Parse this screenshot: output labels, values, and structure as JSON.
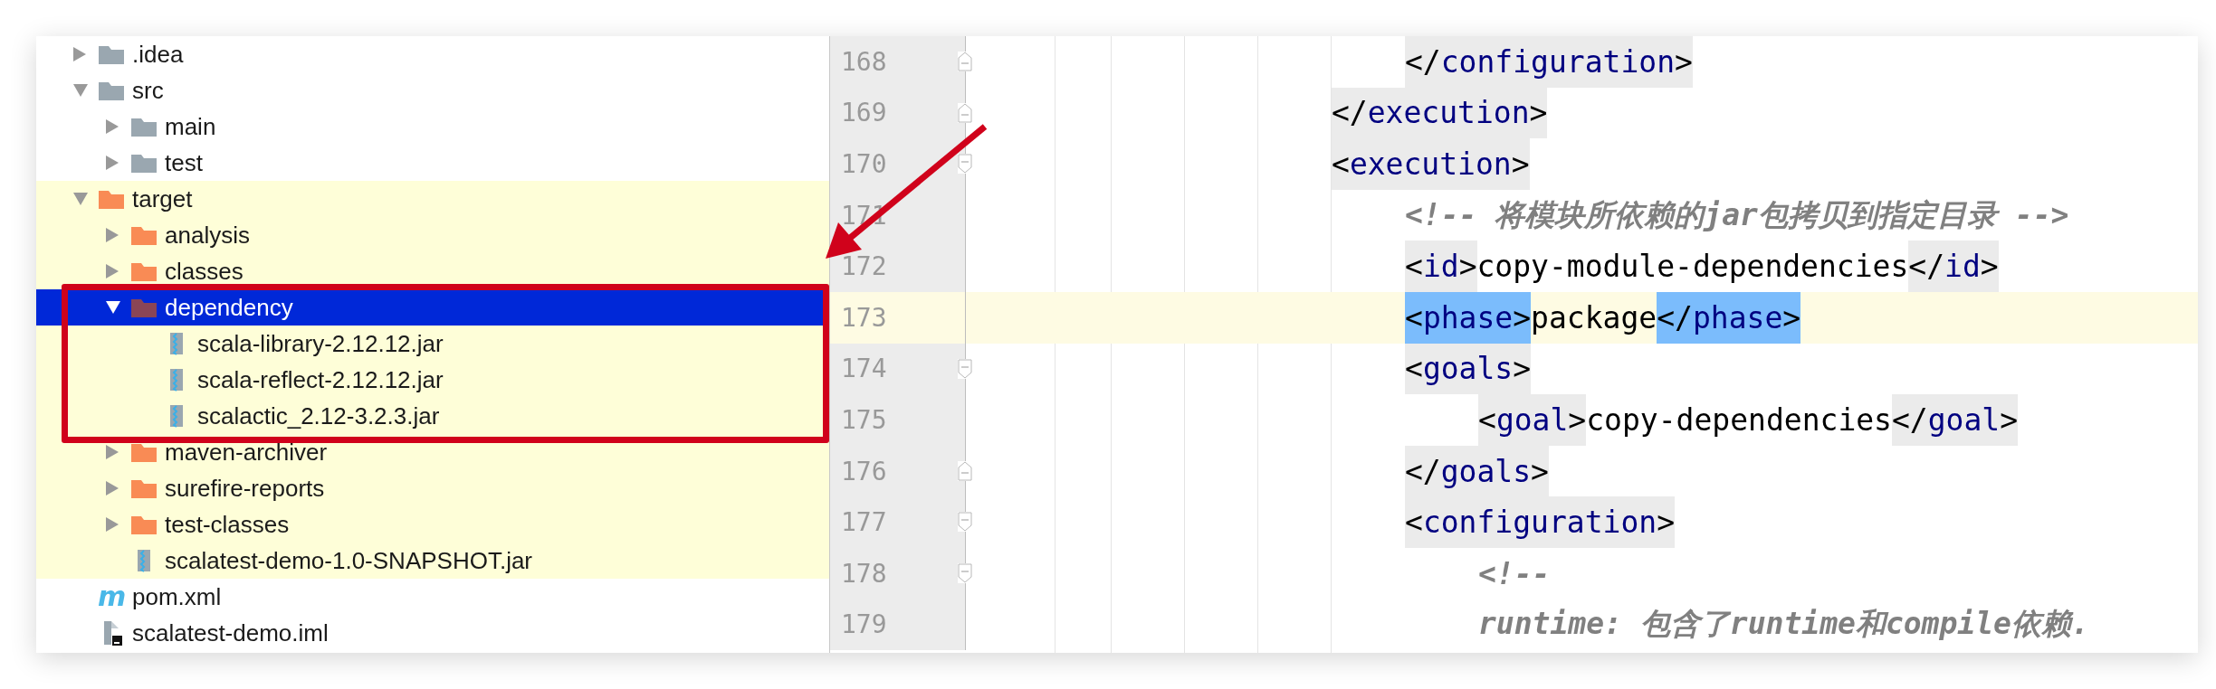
{
  "project_tree": [
    {
      "label": ".idea",
      "kind": "folder",
      "expanded": false,
      "selected": false,
      "excluded": false
    },
    {
      "label": "src",
      "kind": "folder",
      "expanded": true,
      "selected": false,
      "excluded": false,
      "children": [
        {
          "label": "main",
          "kind": "folder",
          "expanded": false,
          "selected": false,
          "excluded": false
        },
        {
          "label": "test",
          "kind": "folder",
          "expanded": false,
          "selected": false,
          "excluded": false
        }
      ]
    },
    {
      "label": "target",
      "kind": "folder",
      "expanded": true,
      "selected": false,
      "excluded": true,
      "children": [
        {
          "label": "analysis",
          "kind": "folder",
          "expanded": false,
          "selected": false,
          "excluded": true
        },
        {
          "label": "classes",
          "kind": "folder",
          "expanded": false,
          "selected": false,
          "excluded": true
        },
        {
          "label": "dependency",
          "kind": "folder",
          "expanded": true,
          "selected": true,
          "excluded": true,
          "children": [
            {
              "label": "scala-library-2.12.12.jar",
              "kind": "jar",
              "selected": false,
              "excluded": true
            },
            {
              "label": "scala-reflect-2.12.12.jar",
              "kind": "jar",
              "selected": false,
              "excluded": true
            },
            {
              "label": "scalactic_2.12-3.2.3.jar",
              "kind": "jar",
              "selected": false,
              "excluded": true
            }
          ]
        },
        {
          "label": "maven-archiver",
          "kind": "folder",
          "expanded": false,
          "selected": false,
          "excluded": true
        },
        {
          "label": "surefire-reports",
          "kind": "folder",
          "expanded": false,
          "selected": false,
          "excluded": true
        },
        {
          "label": "test-classes",
          "kind": "folder",
          "expanded": false,
          "selected": false,
          "excluded": true
        },
        {
          "label": "scalatest-demo-1.0-SNAPSHOT.jar",
          "kind": "jar",
          "selected": false,
          "excluded": true
        }
      ]
    },
    {
      "label": "pom.xml",
      "kind": "maven",
      "badge": "m",
      "selected": false,
      "excluded": false
    },
    {
      "label": "scalatest-demo.iml",
      "kind": "module",
      "selected": false,
      "excluded": false
    }
  ],
  "editor": {
    "lines": [
      {
        "children": [
          {
            "number": "168",
            "fold_start": false,
            "fold_end": true,
            "current": false,
            "tokens": [
              {
                "kind": "tag",
                "parts": [
                  "</",
                  "configuration",
                  ">"
                ],
                "matched": false
              }
            ]
          }
        ]
      },
      {
        "number": "169",
        "fold_start": false,
        "fold_end": true,
        "current": false,
        "tokens": [
          {
            "kind": "tag",
            "parts": [
              "</",
              "execution",
              ">"
            ],
            "matched": false
          }
        ]
      },
      {
        "number": "170",
        "fold_start": true,
        "fold_end": false,
        "current": false,
        "tokens": [
          {
            "kind": "tag",
            "parts": [
              "<",
              "execution",
              ">"
            ],
            "matched": false
          }
        ],
        "children": [
          {
            "number": "171",
            "fold_start": false,
            "fold_end": false,
            "current": false,
            "tokens": [
              {
                "kind": "comment",
                "text": "<!-- 将模块所依赖的jar包拷贝到指定目录 -->"
              }
            ]
          },
          {
            "number": "172",
            "fold_start": false,
            "fold_end": false,
            "current": false,
            "tokens": [
              {
                "kind": "tag",
                "parts": [
                  "<",
                  "id",
                  ">"
                ],
                "matched": false
              },
              {
                "kind": "text",
                "text": "copy-module-dependencies"
              },
              {
                "kind": "tag",
                "parts": [
                  "</",
                  "id",
                  ">"
                ],
                "matched": false
              }
            ]
          },
          {
            "number": "173",
            "fold_start": false,
            "fold_end": false,
            "current": true,
            "tokens": [
              {
                "kind": "tag",
                "parts": [
                  "<",
                  "phase",
                  ">"
                ],
                "matched": true
              },
              {
                "kind": "text",
                "text": "package"
              },
              {
                "kind": "tag",
                "parts": [
                  "</",
                  "phase",
                  ">"
                ],
                "matched": true
              }
            ]
          },
          {
            "number": "174",
            "fold_start": true,
            "fold_end": false,
            "current": false,
            "tokens": [
              {
                "kind": "tag",
                "parts": [
                  "<",
                  "goals",
                  ">"
                ],
                "matched": false
              }
            ],
            "children": [
              {
                "number": "175",
                "fold_start": false,
                "fold_end": false,
                "current": false,
                "tokens": [
                  {
                    "kind": "tag",
                    "parts": [
                      "<",
                      "goal",
                      ">"
                    ],
                    "matched": false
                  },
                  {
                    "kind": "text",
                    "text": "copy-dependencies"
                  },
                  {
                    "kind": "tag",
                    "parts": [
                      "</",
                      "goal",
                      ">"
                    ],
                    "matched": false
                  }
                ]
              }
            ]
          },
          {
            "number": "176",
            "fold_start": false,
            "fold_end": true,
            "current": false,
            "tokens": [
              {
                "kind": "tag",
                "parts": [
                  "</",
                  "goals",
                  ">"
                ],
                "matched": false
              }
            ]
          },
          {
            "number": "177",
            "fold_start": true,
            "fold_end": false,
            "current": false,
            "tokens": [
              {
                "kind": "tag",
                "parts": [
                  "<",
                  "configuration",
                  ">"
                ],
                "matched": false
              }
            ],
            "children": [
              {
                "number": "178",
                "fold_start": true,
                "fold_end": false,
                "current": false,
                "tokens": [
                  {
                    "kind": "comment",
                    "text": "<!--"
                  }
                ]
              },
              {
                "number": "179",
                "fold_start": false,
                "fold_end": false,
                "current": false,
                "tokens": [
                  {
                    "kind": "comment",
                    "text": "runtime: 包含了runtime和compile依赖."
                  }
                ]
              }
            ]
          }
        ]
      }
    ]
  }
}
